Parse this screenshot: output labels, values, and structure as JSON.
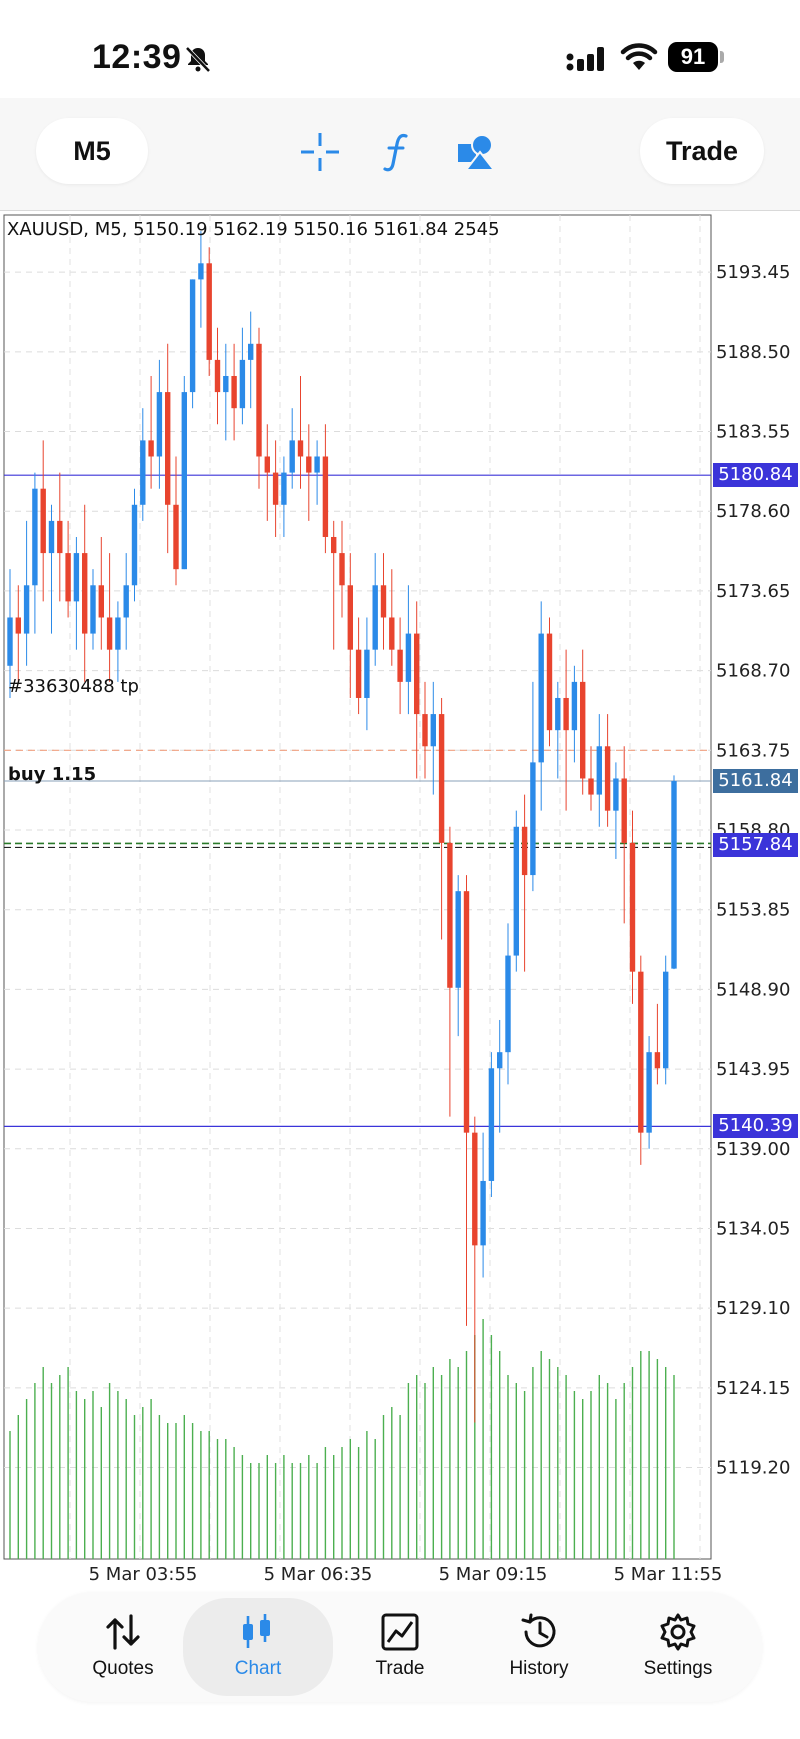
{
  "status_bar": {
    "time": "12:39",
    "battery": "91"
  },
  "toolbar": {
    "timeframe": "M5",
    "trade_label": "Trade"
  },
  "chart": {
    "header": "XAUUSD, M5, 5150.19 5162.19 5150.16 5161.84 2545",
    "tp_label": "#33630488 tp",
    "buy_label": "buy 1.15",
    "price_tags": {
      "upper_line": "5180.84",
      "current": "5161.84",
      "buy": "5157.84",
      "lower_line": "5140.39"
    },
    "colors": {
      "bull": "#2b8ae8",
      "bear": "#e8442e",
      "line": "#3b34d9",
      "buy_tag": "#3b34d9",
      "current_tag": "#3d6e9e",
      "volume": "#4caf50"
    }
  },
  "chart_data": {
    "type": "candlestick",
    "symbol": "XAUUSD",
    "timeframe": "M5",
    "y_ticks": [
      "5193.45",
      "5188.50",
      "5183.55",
      "5178.60",
      "5173.65",
      "5168.70",
      "5163.75",
      "5158.80",
      "5153.85",
      "5148.90",
      "5143.95",
      "5139.00",
      "5134.05",
      "5129.10",
      "5124.15",
      "5119.20"
    ],
    "x_ticks": [
      "5 Mar 03:55",
      "5 Mar 06:35",
      "5 Mar 09:15",
      "5 Mar 11:55"
    ],
    "ylim": [
      5116.5,
      5197.0
    ],
    "candles": [
      [
        5169,
        5175,
        5167,
        5172
      ],
      [
        5172,
        5174,
        5168,
        5171
      ],
      [
        5171,
        5178,
        5169,
        5174
      ],
      [
        5174,
        5181,
        5171,
        5180
      ],
      [
        5180,
        5183,
        5173,
        5176
      ],
      [
        5176,
        5179,
        5171,
        5178
      ],
      [
        5178,
        5181,
        5173,
        5176
      ],
      [
        5176,
        5178,
        5172,
        5173
      ],
      [
        5173,
        5177,
        5170,
        5176
      ],
      [
        5176,
        5179,
        5168,
        5171
      ],
      [
        5171,
        5175,
        5170,
        5174
      ],
      [
        5174,
        5177,
        5170,
        5172
      ],
      [
        5172,
        5176,
        5168,
        5170
      ],
      [
        5170,
        5173,
        5168,
        5172
      ],
      [
        5172,
        5176,
        5170,
        5174
      ],
      [
        5174,
        5180,
        5173,
        5179
      ],
      [
        5179,
        5185,
        5178,
        5183
      ],
      [
        5183,
        5187,
        5180,
        5182
      ],
      [
        5182,
        5188,
        5180,
        5186
      ],
      [
        5186,
        5189,
        5176,
        5179
      ],
      [
        5179,
        5182,
        5174,
        5175
      ],
      [
        5175,
        5187,
        5175,
        5186
      ],
      [
        5186,
        5193,
        5185,
        5193
      ],
      [
        5193,
        5196,
        5190,
        5194
      ],
      [
        5194,
        5195,
        5187,
        5188
      ],
      [
        5188,
        5190,
        5184,
        5186
      ],
      [
        5186,
        5189,
        5183,
        5187
      ],
      [
        5187,
        5189,
        5183,
        5185
      ],
      [
        5185,
        5190,
        5184,
        5188
      ],
      [
        5188,
        5191,
        5185,
        5189
      ],
      [
        5189,
        5190,
        5180,
        5182
      ],
      [
        5182,
        5184,
        5178,
        5181
      ],
      [
        5181,
        5183,
        5177,
        5179
      ],
      [
        5179,
        5182,
        5177,
        5181
      ],
      [
        5181,
        5185,
        5180,
        5183
      ],
      [
        5183,
        5187,
        5180,
        5182
      ],
      [
        5182,
        5184,
        5178,
        5181
      ],
      [
        5181,
        5183,
        5179,
        5182
      ],
      [
        5182,
        5184,
        5176,
        5177
      ],
      [
        5177,
        5178,
        5170,
        5176
      ],
      [
        5176,
        5178,
        5172,
        5174
      ],
      [
        5174,
        5176,
        5167,
        5170
      ],
      [
        5170,
        5172,
        5166,
        5167
      ],
      [
        5167,
        5172,
        5165,
        5170
      ],
      [
        5170,
        5176,
        5169,
        5174
      ],
      [
        5174,
        5176,
        5170,
        5172
      ],
      [
        5172,
        5175,
        5169,
        5170
      ],
      [
        5170,
        5172,
        5166,
        5168
      ],
      [
        5168,
        5174,
        5166,
        5171
      ],
      [
        5171,
        5173,
        5162,
        5166
      ],
      [
        5166,
        5168,
        5162,
        5164
      ],
      [
        5164,
        5168,
        5161,
        5166
      ],
      [
        5166,
        5167,
        5152,
        5158
      ],
      [
        5158,
        5159,
        5141,
        5149
      ],
      [
        5149,
        5156,
        5146,
        5155
      ],
      [
        5155,
        5156,
        5128,
        5140
      ],
      [
        5140,
        5141,
        5122,
        5133
      ],
      [
        5133,
        5140,
        5131,
        5137
      ],
      [
        5137,
        5145,
        5136,
        5144
      ],
      [
        5144,
        5147,
        5140,
        5145
      ],
      [
        5145,
        5153,
        5143,
        5151
      ],
      [
        5151,
        5160,
        5150,
        5159
      ],
      [
        5159,
        5161,
        5150,
        5156
      ],
      [
        5156,
        5168,
        5155,
        5163
      ],
      [
        5163,
        5173,
        5160,
        5171
      ],
      [
        5171,
        5172,
        5164,
        5165
      ],
      [
        5165,
        5168,
        5162,
        5167
      ],
      [
        5167,
        5170,
        5160,
        5165
      ],
      [
        5165,
        5169,
        5163,
        5168
      ],
      [
        5168,
        5170,
        5161,
        5162
      ],
      [
        5162,
        5164,
        5160,
        5161
      ],
      [
        5161,
        5166,
        5159,
        5164
      ],
      [
        5164,
        5166,
        5159,
        5160
      ],
      [
        5160,
        5163,
        5157,
        5162
      ],
      [
        5162,
        5164,
        5153,
        5158
      ],
      [
        5158,
        5160,
        5148,
        5150
      ],
      [
        5150,
        5151,
        5138,
        5140
      ],
      [
        5140,
        5146,
        5139,
        5145
      ],
      [
        5145,
        5148,
        5143,
        5144
      ],
      [
        5144,
        5151,
        5143,
        5150
      ],
      [
        5150.19,
        5162.19,
        5150.16,
        5161.84
      ]
    ],
    "volume": [
      16,
      18,
      20,
      22,
      24,
      22,
      23,
      24,
      21,
      20,
      21,
      19,
      22,
      21,
      20,
      18,
      19,
      20,
      18,
      17,
      17,
      18,
      17,
      16,
      16,
      15,
      15,
      14,
      13,
      12,
      12,
      13,
      12,
      13,
      12,
      12,
      13,
      12,
      14,
      13,
      14,
      15,
      14,
      16,
      15,
      18,
      19,
      18,
      22,
      23,
      22,
      24,
      23,
      25,
      24,
      26,
      28,
      30,
      28,
      26,
      23,
      22,
      21,
      24,
      26,
      25,
      24,
      23,
      21,
      20,
      21,
      23,
      22,
      20,
      22,
      24,
      26,
      26,
      25,
      24,
      23
    ],
    "horizontal_lines": [
      {
        "price": 5180.84,
        "label": "5180.84",
        "style": "solid"
      },
      {
        "price": 5163.75,
        "label": "#33630488 tp",
        "style": "dashed"
      },
      {
        "price": 5161.84,
        "label": "5161.84",
        "style": "current"
      },
      {
        "price": 5157.84,
        "label": "buy 1.15",
        "style": "dashed"
      },
      {
        "price": 5140.39,
        "label": "5140.39",
        "style": "solid"
      }
    ]
  },
  "nav": {
    "items": [
      {
        "label": "Quotes",
        "icon": "quotes-icon"
      },
      {
        "label": "Chart",
        "icon": "chart-icon"
      },
      {
        "label": "Trade",
        "icon": "trade-icon"
      },
      {
        "label": "History",
        "icon": "history-icon"
      },
      {
        "label": "Settings",
        "icon": "settings-icon"
      }
    ]
  }
}
